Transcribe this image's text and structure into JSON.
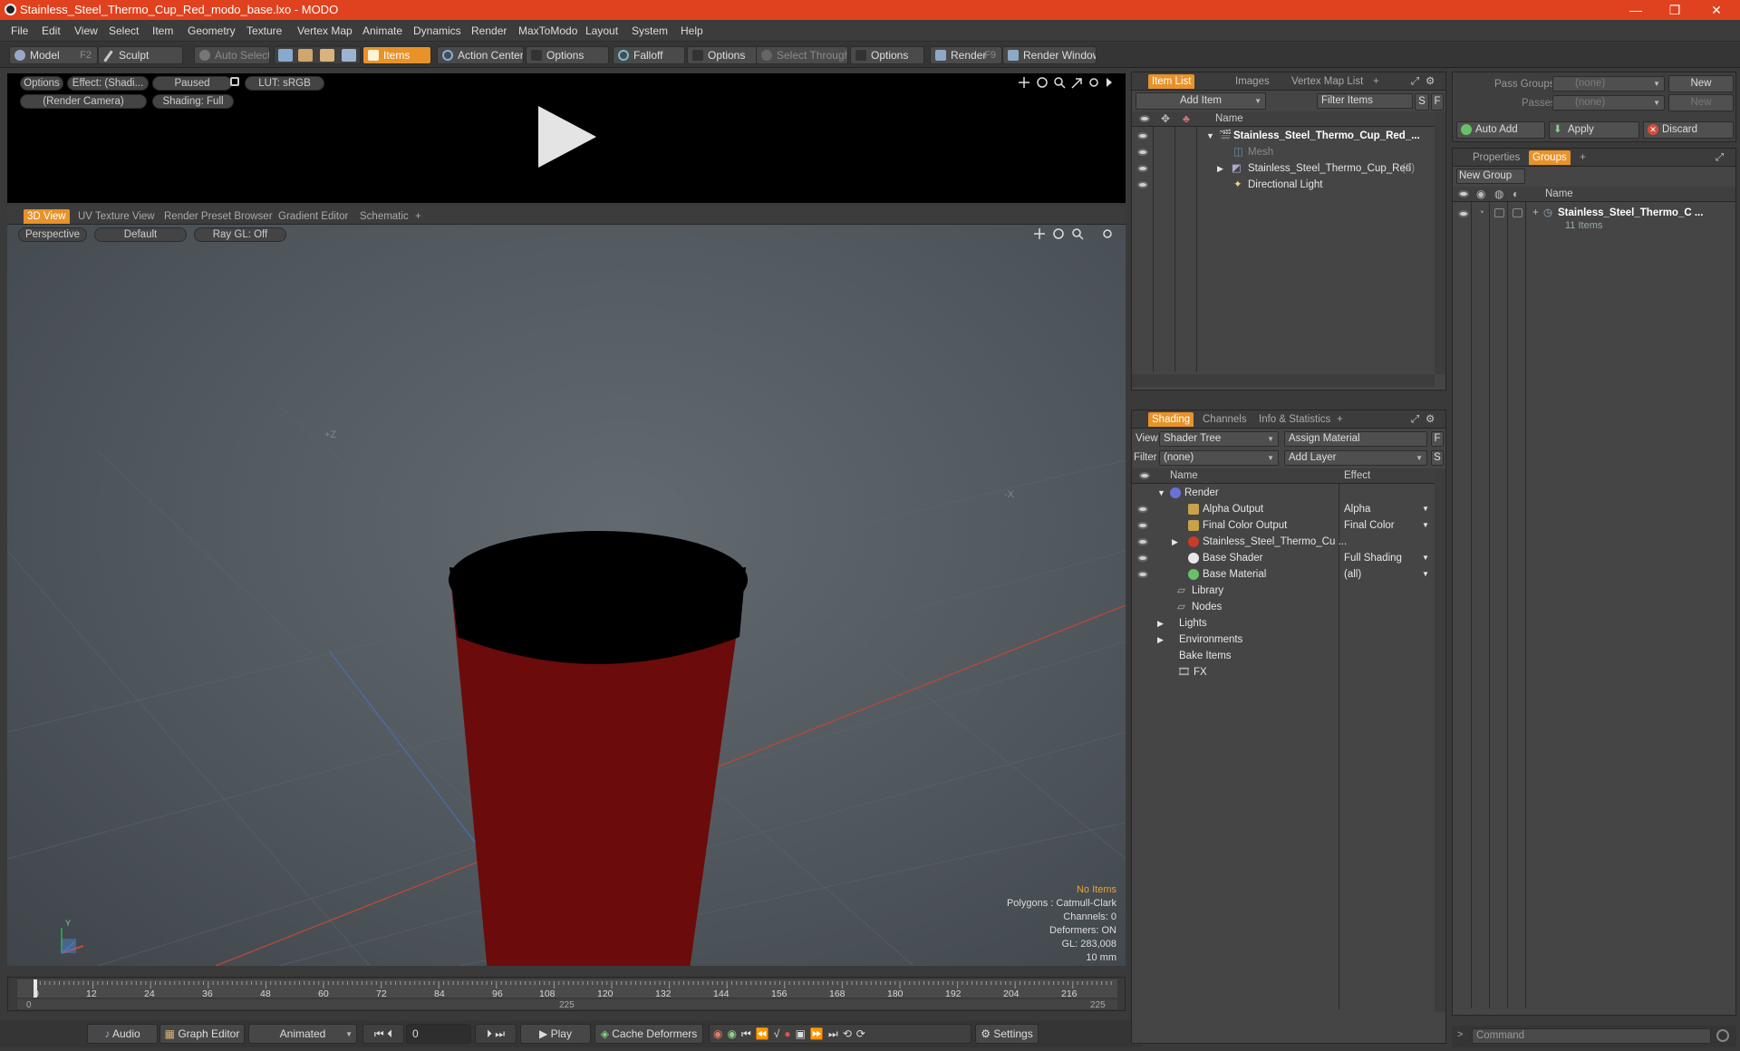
{
  "window": {
    "title": "Stainless_Steel_Thermo_Cup_Red_modo_base.lxo - MODO",
    "minimize": "—",
    "maximize": "❐",
    "close": "✕"
  },
  "menu": [
    "File",
    "Edit",
    "View",
    "Select",
    "Item",
    "Geometry",
    "Texture",
    "Vertex Map",
    "Animate",
    "Dynamics",
    "Render",
    "MaxToModo",
    "Layout",
    "System",
    "Help"
  ],
  "toolbar": {
    "model": "Model",
    "model_key": "F2",
    "sculpt": "Sculpt",
    "auto_select": "Auto Select",
    "items": "Items",
    "action_center": "Action Center",
    "options1": "Options",
    "falloff": "Falloff",
    "options2": "Options",
    "select_through": "Select Through",
    "options3": "Options",
    "render": "Render",
    "render_key": "F9",
    "render_window": "Render Window"
  },
  "render_preview": {
    "options": "Options",
    "effect": "Effect: (Shadi...",
    "paused": "Paused",
    "lut": "LUT: sRGB",
    "camera": "(Render Camera)",
    "shading": "Shading: Full"
  },
  "viewport_tabs": [
    "3D View",
    "UV Texture View",
    "Render Preset Browser",
    "Gradient Editor",
    "Schematic",
    "+"
  ],
  "viewport": {
    "perspective": "Perspective",
    "default": "Default",
    "raygl": "Ray GL: Off",
    "axis_z": "+Z",
    "axis_x": "-X",
    "gizmo_y": "Y",
    "info": {
      "no_items": "No Items",
      "polygons": "Polygons : Catmull-Clark",
      "channels": "Channels: 0",
      "deformers": "Deformers: ON",
      "gl": "GL: 283,008",
      "scale": "10 mm"
    }
  },
  "timeline": {
    "ticks": [
      "0",
      "12",
      "24",
      "36",
      "48",
      "60",
      "72",
      "84",
      "96",
      "108",
      "120",
      "132",
      "144",
      "156",
      "168",
      "180",
      "192",
      "204",
      "216"
    ],
    "start": "0",
    "mid": "225",
    "end": "225"
  },
  "bottombar": {
    "audio": "Audio",
    "graph_editor": "Graph Editor",
    "animated": "Animated",
    "frame": "0",
    "play": "Play",
    "cache_deformers": "Cache Deformers",
    "settings": "Settings"
  },
  "item_list": {
    "tabs": [
      "Item List",
      "Images",
      "Vertex Map List",
      "+"
    ],
    "add_item": "Add Item",
    "filter_items": "Filter Items",
    "s": "S",
    "f": "F",
    "col_name": "Name",
    "rows": [
      {
        "label": "Stainless_Steel_Thermo_Cup_Red_...",
        "count": ""
      },
      {
        "label": "Mesh",
        "count": ""
      },
      {
        "label": "Stainless_Steel_Thermo_Cup_Red",
        "count": "(2)"
      },
      {
        "label": "Directional Light",
        "count": ""
      }
    ]
  },
  "shading": {
    "tabs": [
      "Shading",
      "Channels",
      "Info & Statistics",
      "+"
    ],
    "view_label": "View",
    "view_value": "Shader Tree",
    "assign_material": "Assign Material",
    "f": "F",
    "filter_label": "Filter",
    "filter_value": "(none)",
    "add_layer": "Add Layer",
    "s": "S",
    "col_name": "Name",
    "col_effect": "Effect",
    "rows": [
      {
        "name": "Render",
        "effect": ""
      },
      {
        "name": "Alpha Output",
        "effect": "Alpha"
      },
      {
        "name": "Final Color Output",
        "effect": "Final Color"
      },
      {
        "name": "Stainless_Steel_Thermo_Cu ...",
        "effect": ""
      },
      {
        "name": "Base Shader",
        "effect": "Full Shading"
      },
      {
        "name": "Base Material",
        "effect": "(all)"
      },
      {
        "name": "Library",
        "effect": ""
      },
      {
        "name": "Nodes",
        "effect": ""
      },
      {
        "name": "Lights",
        "effect": ""
      },
      {
        "name": "Environments",
        "effect": ""
      },
      {
        "name": "Bake Items",
        "effect": ""
      },
      {
        "name": "FX",
        "effect": ""
      }
    ]
  },
  "pass_groups": {
    "pass_groups_label": "Pass Groups",
    "pass_groups_value": "(none)",
    "new1": "New",
    "passes_label": "Passes",
    "passes_value": "(none)",
    "new2": "New",
    "auto_add": "Auto Add",
    "apply": "Apply",
    "discard": "Discard"
  },
  "groups": {
    "tabs": [
      "Properties",
      "Groups",
      "+"
    ],
    "new_group": "New Group",
    "col_name": "Name",
    "item_label": "Stainless_Steel_Thermo_C ...",
    "item_count": "11 Items"
  },
  "command": {
    "placeholder": "Command"
  },
  "colors": {
    "title_bar": "#e0411e",
    "accent": "#e8922a",
    "cup_red": "#6b0b0b"
  }
}
